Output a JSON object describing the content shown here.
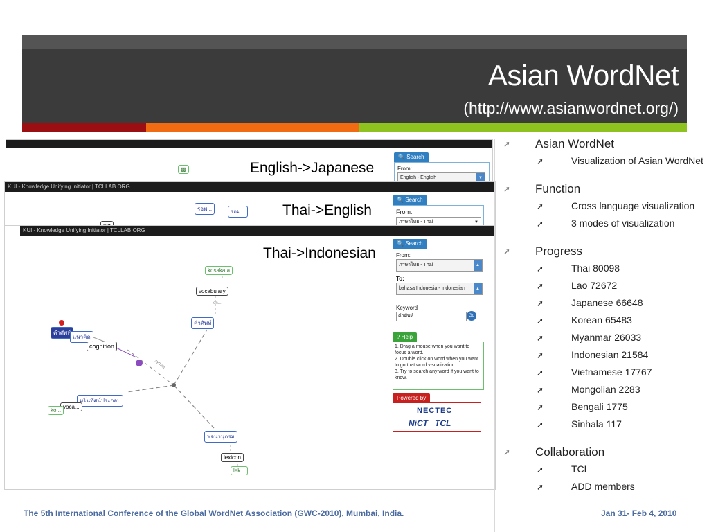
{
  "slide": {
    "title": "Asian WordNet",
    "subtitle": "(http://www.asianwordnet.org/)",
    "colors": {
      "header": "#3b3b3b",
      "bar_red": "#9b0e12",
      "bar_orange": "#f06b12",
      "bar_green": "#8dc21f"
    }
  },
  "screenshots": {
    "s1": {
      "label": "English->Japanese",
      "from_label": "From:",
      "from_value": "English - English",
      "search_tab": "Search"
    },
    "s2": {
      "titlebar": "KUI - Knowledge Unifying Initiator | TCLLAB.ORG",
      "label": "Thai->English",
      "from_label": "From:",
      "from_value": "ภาษาไทย - Thai",
      "search_tab": "Search",
      "node_a": "รอพ...",
      "node_b": "รอม...",
      "node_c": "car"
    },
    "s3": {
      "titlebar": "KUI - Knowledge Unifying Initiator | TCLLAB.ORG",
      "label": "Thai->Indonesian",
      "search_tab": "Search",
      "from_label": "From:",
      "from_value": "ภาษาไทย - Thai",
      "to_label": "To:",
      "to_value": "bahasa Indonesia - Indonesian",
      "keyword_label": "Keyword :",
      "keyword_value": "คำศัพท์",
      "go_label": "Go",
      "help_tab": "Help",
      "help_lines": [
        "1. Drag a mouse when you want to focus a word.",
        "2. Double click on word when you want to go that word visualization.",
        "3. Try to search any word if you want to know."
      ],
      "powered_tab": "Powered by",
      "logo_nectec": "NECTEC",
      "logo_nict": "NiCT",
      "logo_tcl": "TCL",
      "nodes": {
        "kosakata": "kosakata",
        "vocabulary": "vocabulary",
        "kham_sap": "คำศัพท์",
        "kham_sap_red": "คำศัพท์",
        "naeo": "แนวคิด",
        "cognition": "cognition",
        "mono": "มโนทัศน์ประกอบ",
        "voca": "voca...",
        "ko": "ko...",
        "photjananukrom": "พจนานุกรม",
        "lexicon": "lexicon",
        "lek": "lek...",
        "synset": "synset",
        "en": "en..."
      }
    }
  },
  "bullets": [
    {
      "label": "Asian WordNet",
      "items": [
        "Visualization of Asian WordNet"
      ]
    },
    {
      "label": "Function",
      "items": [
        "Cross language visualization",
        "3 modes of visualization"
      ]
    },
    {
      "label": "Progress",
      "items": [
        "Thai 80098",
        "Lao 72672",
        "Japanese 66648",
        "Korean 65483",
        "Myanmar 26033",
        "Indonesian 21584",
        "Vietnamese 17767",
        "Mongolian 2283",
        "Bengali 1775",
        "Sinhala 117"
      ]
    },
    {
      "label": "Collaboration",
      "items": [
        "TCL",
        "ADD members"
      ]
    }
  ],
  "footer": {
    "conference": "The 5th International Conference of the Global WordNet Association (GWC-2010), Mumbai, India.",
    "date": "Jan 31- Feb 4, 2010"
  }
}
